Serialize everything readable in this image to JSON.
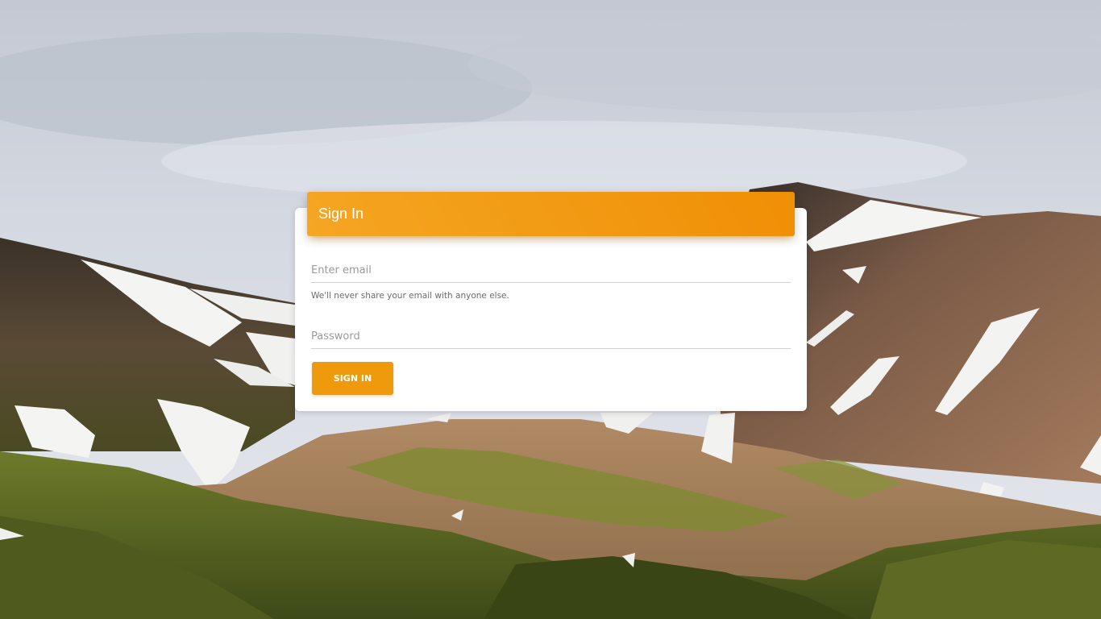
{
  "login": {
    "title": "Sign In",
    "email": {
      "value": "",
      "placeholder": "Enter email",
      "help": "We'll never share your email with anyone else."
    },
    "password": {
      "value": "",
      "placeholder": "Password"
    },
    "submit_label": "SIGN IN"
  },
  "colors": {
    "accent": "#ef9a0d",
    "header_gradient_start": "#f5a623",
    "header_gradient_end": "#ef8f05"
  }
}
